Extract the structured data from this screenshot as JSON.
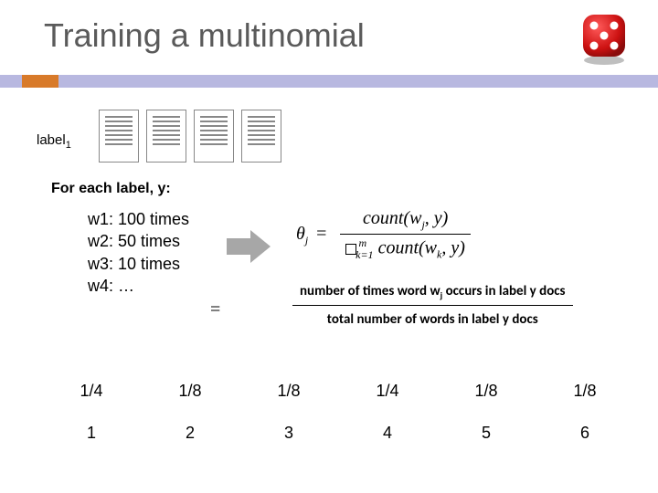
{
  "title": "Training a multinomial",
  "label": "label",
  "label_sub": "1",
  "foreach": "For each label, y:",
  "counts": {
    "w1": "w1: 100 times",
    "w2": "w2: 50 times",
    "w3": "w3: 10 times",
    "w4": "w4: …"
  },
  "formula": {
    "lhs": "θ",
    "lhs_sub": "j",
    "eq": "=",
    "num_a": "count(w",
    "num_sub": "j",
    "num_b": ", y)",
    "den_prefix_sub": "k=1",
    "den_prefix_sup": "m",
    "den_a": " count(w",
    "den_sub": "k",
    "den_b": ", y)"
  },
  "explain": {
    "eq": "=",
    "num": "number of times word w",
    "num_sub": "j",
    "num_tail": " occurs in label y docs",
    "den": "total number of words in label y docs"
  },
  "fractions": [
    "1/4",
    "1/8",
    "1/8",
    "1/4",
    "1/8",
    "1/8"
  ],
  "numbers": [
    "1",
    "2",
    "3",
    "4",
    "5",
    "6"
  ]
}
